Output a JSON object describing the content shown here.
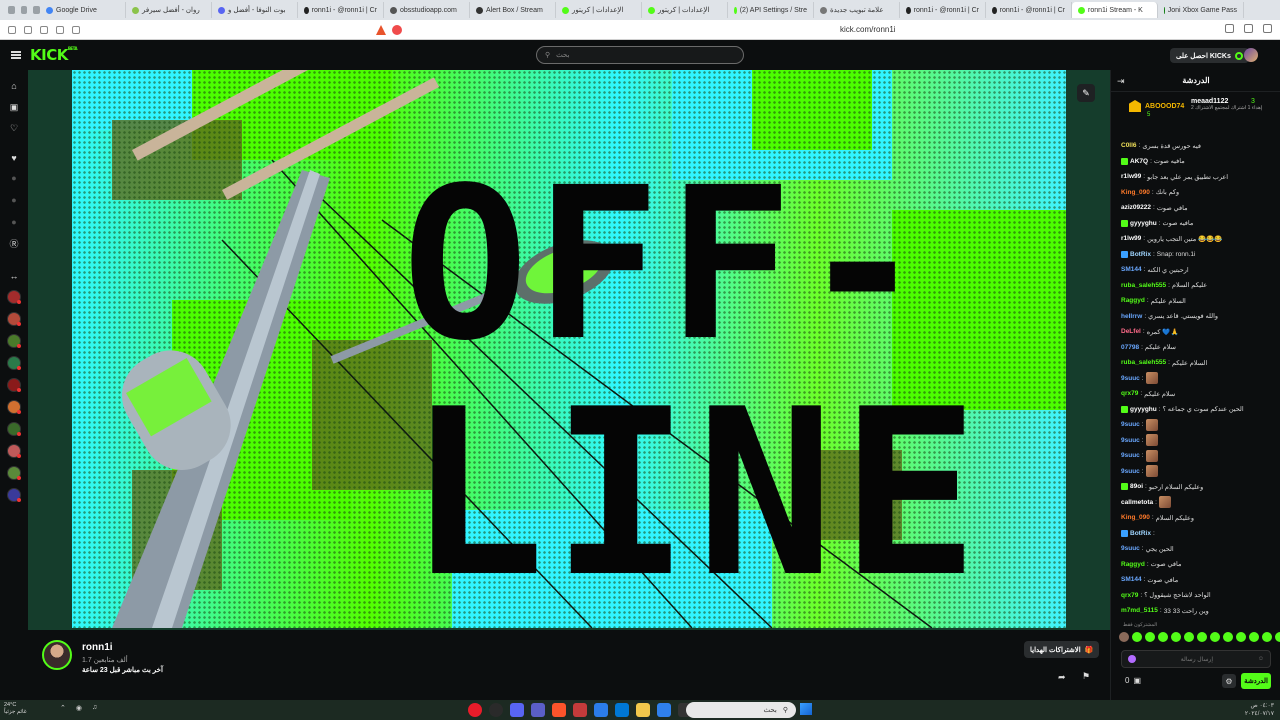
{
  "browser": {
    "tabs": [
      {
        "label": "Google Drive",
        "color": "#4285f4"
      },
      {
        "label": "روان - أفضل سيرفر",
        "color": "#8bc34a"
      },
      {
        "label": "بوت النوفا - أفضل و",
        "color": "#5865f2"
      },
      {
        "label": "ronn1i - @ronn1i | Cr",
        "color": "#222222"
      },
      {
        "label": "obsstudioapp.com",
        "color": "#555555"
      },
      {
        "label": "Alert Box / Stream",
        "color": "#333333"
      },
      {
        "label": "الإعدادات | كريتور",
        "color": "#53fc18"
      },
      {
        "label": "الإعدادات | كريتور",
        "color": "#53fc18"
      },
      {
        "label": "(2) API Settings / Stre",
        "color": "#53fc18"
      },
      {
        "label": "علامة تبويب جديدة",
        "color": "#777777"
      },
      {
        "label": "ronn1i - @ronn1i | Cr",
        "color": "#222222"
      },
      {
        "label": "ronn1i - @ronn1i | Cr",
        "color": "#222222"
      },
      {
        "label": "ronn1i Stream - K",
        "color": "#53fc18",
        "active": true
      },
      {
        "label": "Joni Xbox Game Pass",
        "color": "#107c10"
      }
    ],
    "url": "kick.com/ronn1i"
  },
  "nav": {
    "logo": "KICK",
    "logo_badge": "BETA",
    "search_placeholder": "بحث",
    "kicks_label": "احصل على KICKs"
  },
  "stream": {
    "offline_line1": "OFF-",
    "offline_line2": "LINE",
    "channel_name": "ronn1i",
    "followers": "1.7 ألف متابعين",
    "last_live": "آخر بث مباشر قبل 23 ساعة",
    "gift_button": "الاشتراكات الهدايا"
  },
  "chat": {
    "title": "الدردشة",
    "pinned_left_user": "ABOOOD74",
    "pinned_left_count": "5",
    "pinned_right_user": "meaad1122",
    "pinned_right_count": "3",
    "pinned_right_sub": "إهداء 1 اشتراك لمجتمع الاشتراك 2",
    "messages": [
      {
        "user": "C0ll6",
        "color": "#f0e05a",
        "text": "فيه حورس قدة بسرى"
      },
      {
        "user": "AK7Q",
        "color": "#ffffff",
        "text": "مافيه صوت",
        "badge": "#53fc18"
      },
      {
        "user": "r1lw99",
        "color": "#ffffff",
        "text": "اعرب تطبيق يمر علي بعد جابو"
      },
      {
        "user": "King_090",
        "color": "#ff7a2a",
        "text": "وكم بانك"
      },
      {
        "user": "aziz09222",
        "color": "#ffffff",
        "text": "مافي صوت"
      },
      {
        "user": "gyyyghu",
        "color": "#ffffff",
        "text": "مافيه صوت",
        "badge": "#53fc18"
      },
      {
        "user": "r1lw99",
        "color": "#ffffff",
        "text": "متين التجب ياروين 😂😂😂"
      },
      {
        "user": "BotRix",
        "color": "#9fd5ff",
        "text": "Snap: ronn.1i",
        "badge": "#3aa0ff"
      },
      {
        "user": "SM144",
        "color": "#6aa8ff",
        "text": "ارحبتين ي الكنه"
      },
      {
        "user": "ruba_saleh555",
        "color": "#53fc18",
        "text": "عليكم السلام"
      },
      {
        "user": "Raggyd",
        "color": "#53fc18",
        "text": "السلام عليكم"
      },
      {
        "user": "heIIrrw",
        "color": "#6aa8ff",
        "text": "والله فويستي. قاعد يسري"
      },
      {
        "user": "DeLfel",
        "color": "#ff6b8a",
        "text": "كمره 💙🙏"
      },
      {
        "user": "07798",
        "color": "#6aa8ff",
        "text": "سلام عليكم"
      },
      {
        "user": "ruba_saleh555",
        "color": "#53fc18",
        "text": "السلام عليكم"
      },
      {
        "user": "9suuc",
        "color": "#6aa8ff",
        "text": "",
        "emote": true
      },
      {
        "user": "qrx79",
        "color": "#53fc18",
        "text": "سلام عليكم"
      },
      {
        "user": "gyyyghu",
        "color": "#ffffff",
        "text": "الحين عندكم سوت ي جماعه ؟",
        "badge": "#53fc18"
      },
      {
        "user": "9suuc",
        "color": "#6aa8ff",
        "text": "",
        "emote": true
      },
      {
        "user": "9suuc",
        "color": "#6aa8ff",
        "text": "",
        "emote": true
      },
      {
        "user": "9suuc",
        "color": "#6aa8ff",
        "text": "",
        "emote": true
      },
      {
        "user": "9suuc",
        "color": "#6aa8ff",
        "text": "",
        "emote": true
      },
      {
        "user": "89oi",
        "color": "#ffffff",
        "text": "وعليكم السلام ارحبو",
        "badge": "#53fc18"
      },
      {
        "user": "callmetota",
        "color": "#ffffff",
        "text": "",
        "emote": true
      },
      {
        "user": "King_090",
        "color": "#ff7a2a",
        "text": "وعليكم السلام"
      },
      {
        "user": "BotRix",
        "color": "#9fd5ff",
        "text": "",
        "badge": "#3aa0ff"
      },
      {
        "user": "9suuc",
        "color": "#6aa8ff",
        "text": "الحين يجي"
      },
      {
        "user": "Raggyd",
        "color": "#53fc18",
        "text": "مافي صوت"
      },
      {
        "user": "SM144",
        "color": "#6aa8ff",
        "text": "مافي صوت"
      },
      {
        "user": "qrx79",
        "color": "#53fc18",
        "text": "الواحد لاشاحج شيقوول ؟"
      },
      {
        "user": "m7md_5115",
        "color": "#53fc18",
        "text": "33 33 وين راحت"
      }
    ],
    "emotes_label": "المشتركون فقط",
    "input_placeholder": "إرسال رسالة",
    "kicks_count": "0",
    "send_label": "الدردشة"
  },
  "taskbar": {
    "weather_temp": "24°C",
    "weather_desc": "غائم جزئياً",
    "search_placeholder": "بحث",
    "time": "٠٤:٠٣ ص",
    "date": "٢٠٢٤/٠٧/١٧"
  }
}
